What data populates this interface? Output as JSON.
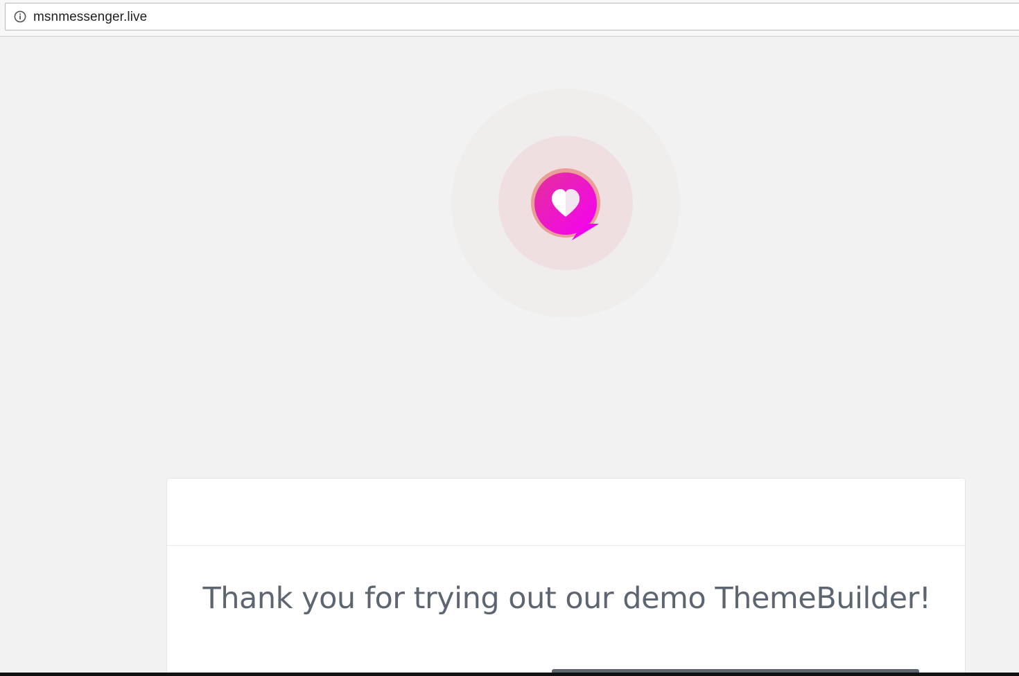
{
  "browser": {
    "url": "msnmessenger.live",
    "info_icon": "info-circle-icon"
  },
  "logo": {
    "icon": "heart-chat-bubble-icon",
    "colors": {
      "outer_halo": "#efeeed",
      "inner_halo": "#f0dfe0",
      "bubble_ring": "#ea9e98",
      "bubble_start": "#e8259c",
      "bubble_end": "#f200f2",
      "heart": "#ffffff"
    }
  },
  "card": {
    "title": "Thank you for trying out our demo ThemeBuilder!"
  },
  "colors": {
    "page_background": "#f2f2f2",
    "title_text": "#5d6570",
    "button": "#5d6570"
  }
}
